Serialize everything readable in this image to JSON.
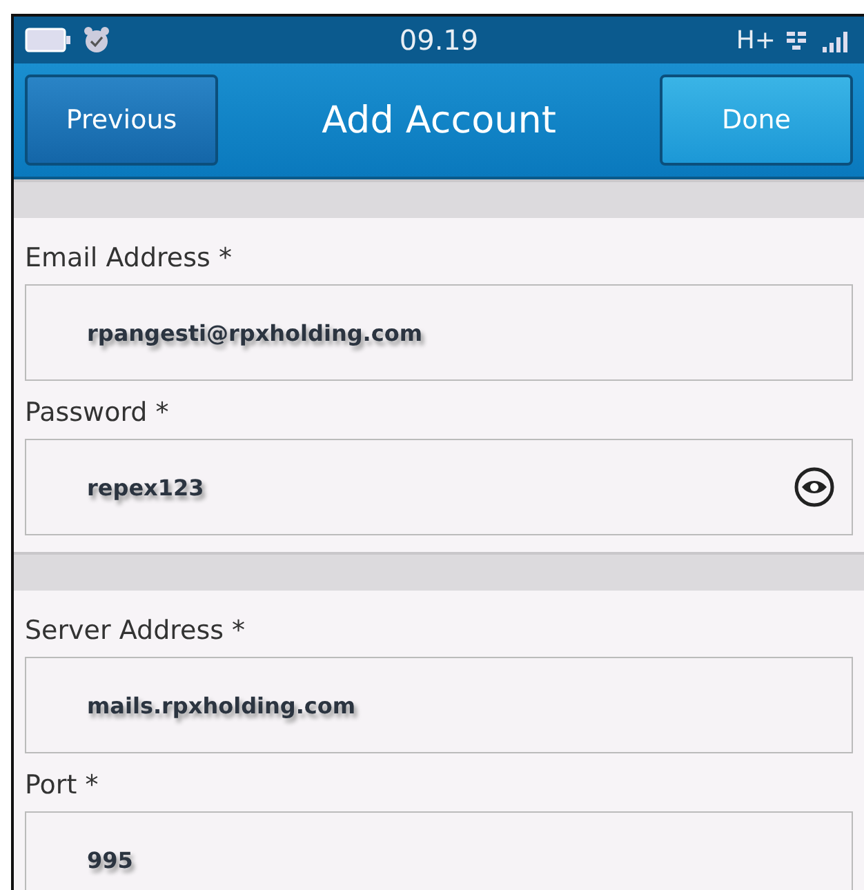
{
  "status_bar": {
    "time": "09.19",
    "network": "H+"
  },
  "title_bar": {
    "title": "Add Account",
    "left_button": "Previous",
    "right_button": "Done"
  },
  "sections": [
    {
      "fields": [
        {
          "kind": "text",
          "label": "Email Address *",
          "value": "rpangesti@rpxholding.com"
        },
        {
          "kind": "password",
          "label": "Password *",
          "value": "repex123"
        }
      ]
    },
    {
      "fields": [
        {
          "kind": "text",
          "label": "Server Address *",
          "value": "mails.rpxholding.com"
        },
        {
          "kind": "text",
          "label": "Port *",
          "value": "995"
        }
      ]
    }
  ]
}
